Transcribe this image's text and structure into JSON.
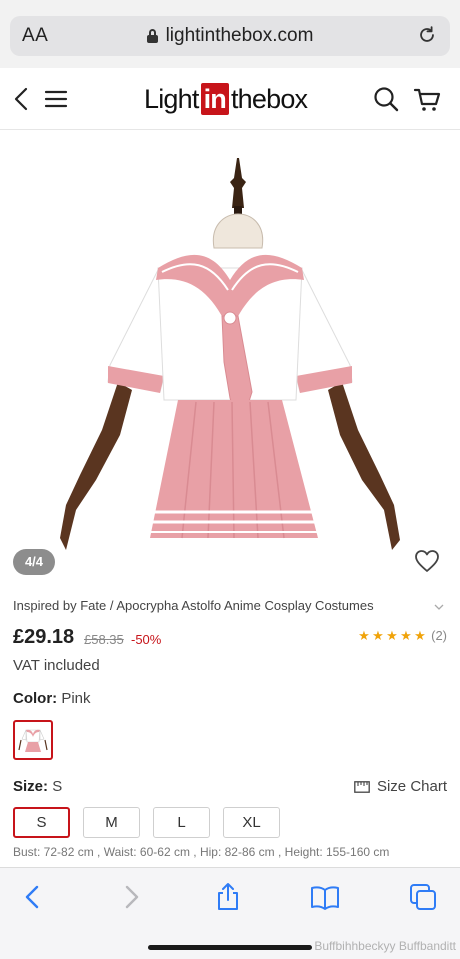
{
  "browser": {
    "text_size_label": "AA",
    "url": "lightinthebox.com"
  },
  "header": {
    "logo": {
      "part1": "Light",
      "part2": "in",
      "part3": "thebox"
    }
  },
  "gallery": {
    "counter": "4/4"
  },
  "product": {
    "title": "Inspired by Fate / Apocrypha Astolfo Anime Cosplay Costumes",
    "price": "£29.18",
    "original_price": "£58.35",
    "discount": "-50%",
    "rating_stars": 5,
    "review_count": "(2)",
    "vat_note": "VAT included",
    "color_label": "Color:",
    "color_value": "Pink",
    "size_label": "Size:",
    "size_value": "S",
    "size_chart_label": "Size Chart",
    "sizes": [
      "S",
      "M",
      "L",
      "XL"
    ],
    "selected_size": "S",
    "measurements": "Bust: 72-82 cm , Waist: 60-62 cm , Hip: 82-86 cm , Height: 155-160 cm"
  },
  "colors": {
    "brand_red": "#c7141a",
    "safari_blue": "#2f7cf6",
    "star": "#f0a30a",
    "pink": "#e8a0a6"
  },
  "watermark": "Buffbihhbeckyy Buffbanditt"
}
